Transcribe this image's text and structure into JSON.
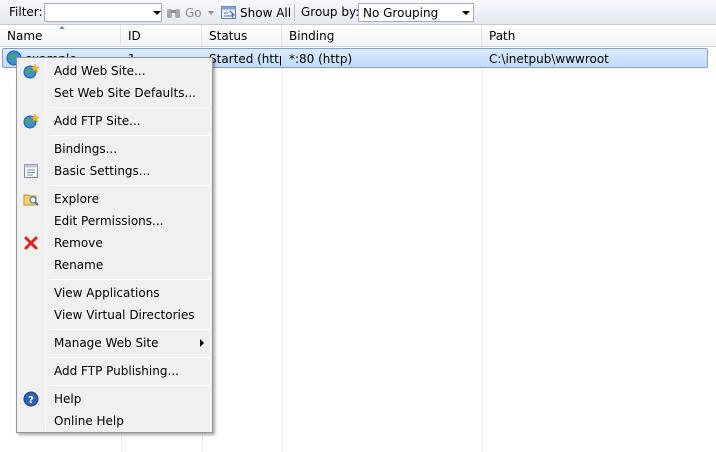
{
  "toolbar": {
    "filter_label": "Filter:",
    "filter_value": "",
    "go_label": "Go",
    "show_all_label": "Show All",
    "group_by_label": "Group by:",
    "group_by_value": "No Grouping"
  },
  "grid": {
    "columns": [
      "Name",
      "ID",
      "Status",
      "Binding",
      "Path"
    ],
    "rows": [
      {
        "name": "example",
        "id": "1",
        "status": "Started (http)",
        "binding": "*:80 (http)",
        "path": "C:\\inetpub\\wwwroot"
      }
    ]
  },
  "context_menu": {
    "items": [
      {
        "label": "Add Web Site...",
        "icon": "add-web-site-globe-icon"
      },
      {
        "label": "Set Web Site Defaults..."
      },
      {
        "label": "Add FTP Site...",
        "icon": "add-ftp-site-globe-icon"
      },
      {
        "label": "Bindings..."
      },
      {
        "label": "Basic Settings...",
        "icon": "basic-settings-icon"
      },
      {
        "label": "Explore",
        "icon": "explore-folder-icon"
      },
      {
        "label": "Edit Permissions..."
      },
      {
        "label": "Remove",
        "icon": "remove-x-icon"
      },
      {
        "label": "Rename"
      },
      {
        "label": "View Applications"
      },
      {
        "label": "View Virtual Directories"
      },
      {
        "label": "Manage Web Site",
        "submenu": true
      },
      {
        "label": "Add FTP Publishing..."
      },
      {
        "label": "Help",
        "icon": "help-icon"
      },
      {
        "label": "Online Help"
      }
    ]
  },
  "colors": {
    "selection": "#c8defc",
    "selection_border": "#7da2ce",
    "menu_bg": "#f0f0f0",
    "remove_red": "#d9261c"
  }
}
